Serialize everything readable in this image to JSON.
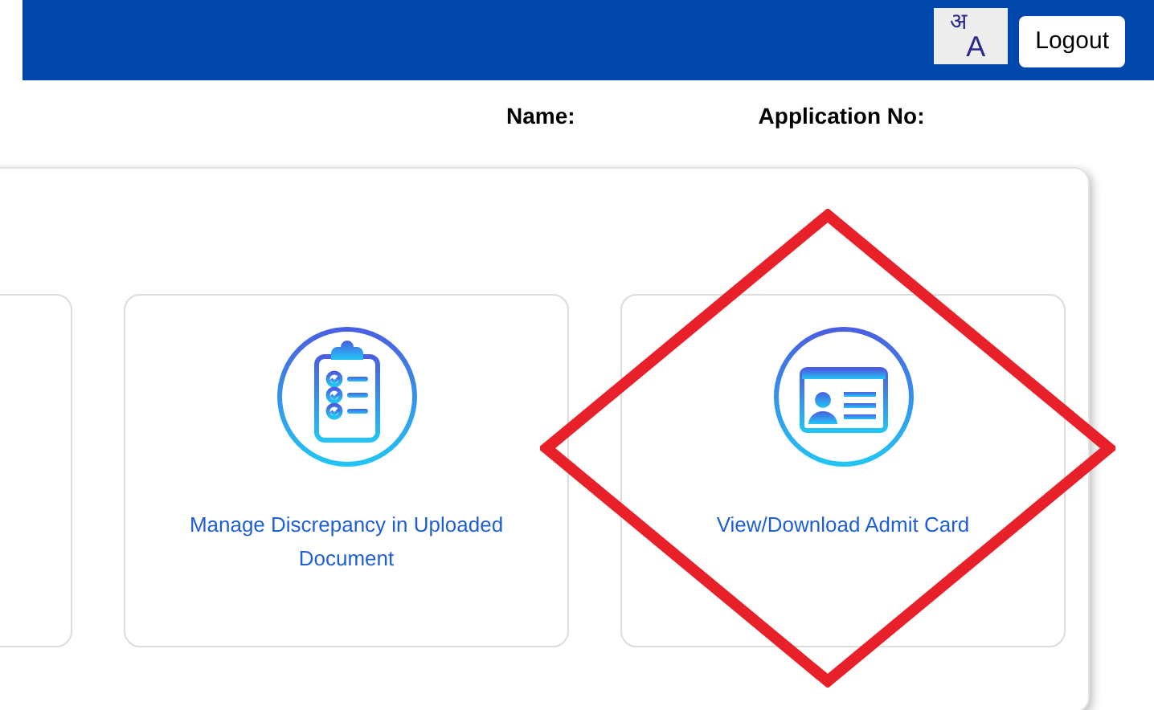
{
  "header": {
    "language_toggle": {
      "top": "अ",
      "bottom": "A"
    },
    "logout": "Logout"
  },
  "info": [
    {
      "label": "Name:"
    },
    {
      "label": "Application No:"
    }
  ],
  "cards": [
    {
      "label": "Manage Discrepancy in Uploaded Document",
      "kind": "checklist"
    },
    {
      "label": "View/Download Admit Card",
      "kind": "identity"
    }
  ]
}
